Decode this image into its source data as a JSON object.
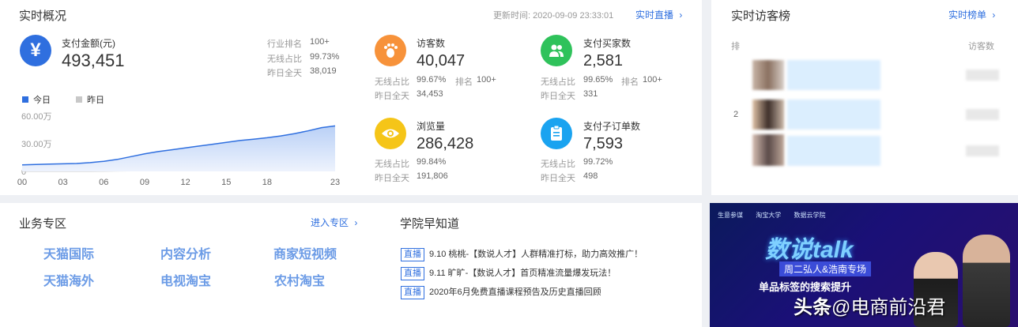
{
  "realtime": {
    "title": "实时概况",
    "update_label": "更新时间:",
    "update_time": "2020-09-09 23:33:01",
    "live_link": "实时直播",
    "pay_amount": {
      "label": "支付金额(元)",
      "value": "493,451",
      "industry_rank_label": "行业排名",
      "industry_rank_value": "100+",
      "wireless_label": "无线占比",
      "wireless_value": "99.73%",
      "yesterday_label": "昨日全天",
      "yesterday_value": "38,019"
    },
    "legend_today": "今日",
    "legend_yesterday": "昨日",
    "metrics": {
      "visitors": {
        "label": "访客数",
        "value": "40,047",
        "wireless_label": "无线占比",
        "wireless_value": "99.67%",
        "rank_label": "排名",
        "rank_value": "100+",
        "yesterday_label": "昨日全天",
        "yesterday_value": "34,453"
      },
      "buyers": {
        "label": "支付买家数",
        "value": "2,581",
        "wireless_label": "无线占比",
        "wireless_value": "99.65%",
        "rank_label": "排名",
        "rank_value": "100+",
        "yesterday_label": "昨日全天",
        "yesterday_value": "331"
      },
      "pageviews": {
        "label": "浏览量",
        "value": "286,428",
        "wireless_label": "无线占比",
        "wireless_value": "99.84%",
        "yesterday_label": "昨日全天",
        "yesterday_value": "191,806"
      },
      "suborders": {
        "label": "支付子订单数",
        "value": "7,593",
        "wireless_label": "无线占比",
        "wireless_value": "99.72%",
        "yesterday_label": "昨日全天",
        "yesterday_value": "498"
      }
    },
    "colors": {
      "accent": "#2f6fdf",
      "visitors": "#f7923a",
      "buyers": "#2fc25b",
      "pageviews": "#f5c518",
      "suborders": "#1aa3f0"
    }
  },
  "chart_data": {
    "type": "area",
    "y_tick_labels": [
      "60.00万",
      "30.00万",
      "0"
    ],
    "x_tick_labels": [
      "00",
      "03",
      "06",
      "09",
      "12",
      "15",
      "18",
      "23"
    ],
    "x": [
      0,
      1,
      2,
      3,
      4,
      5,
      6,
      7,
      8,
      9,
      10,
      11,
      12,
      13,
      14,
      15,
      16,
      17,
      18,
      19,
      20,
      21,
      22,
      23
    ],
    "ylim": [
      0,
      600000
    ],
    "series": [
      {
        "name": "今日",
        "color": "#2f6fdf",
        "values": [
          70000,
          75000,
          80000,
          82000,
          86000,
          95000,
          110000,
          130000,
          160000,
          190000,
          215000,
          235000,
          255000,
          275000,
          295000,
          315000,
          335000,
          350000,
          365000,
          385000,
          410000,
          440000,
          475000,
          493451
        ]
      },
      {
        "name": "昨日",
        "color": "#c8c8c8",
        "values": [
          1500,
          1600,
          1700,
          1800,
          2000,
          2500,
          3500,
          5000,
          7000,
          9000,
          11000,
          13000,
          15000,
          17000,
          19000,
          21000,
          23000,
          25500,
          28000,
          30500,
          33000,
          35000,
          37000,
          38019
        ]
      }
    ],
    "grid": false,
    "legend": "top-left"
  },
  "rank": {
    "title": "实时访客榜",
    "link": "实时榜单",
    "col_rank": "排",
    "col_visitors": "访客数",
    "rows": [
      "",
      "2",
      ""
    ]
  },
  "business": {
    "title": "业务专区",
    "link": "进入专区",
    "items": [
      "天猫国际",
      "内容分析",
      "商家短视频",
      "天猫海外",
      "电视淘宝",
      "农村淘宝"
    ]
  },
  "academy": {
    "title": "学院早知道",
    "tag": "直播",
    "items": [
      "9.10 桃桃-【数说人才】人群精准打标，助力高效推广！",
      "9.11 旷旷-【数说人才】首页精准流量爆发玩法！",
      "2020年6月免费直播课程预告及历史直播回顾"
    ]
  },
  "banner": {
    "logos": [
      "生意参谋",
      "淘宝大学",
      "数据云学院"
    ],
    "headline": "数说talk",
    "subtitle": "周二弘人&浩南专场",
    "topic": "单品标签的搜索提升",
    "watermark_prefix": "头条",
    "watermark_text": "@电商前沿君"
  }
}
